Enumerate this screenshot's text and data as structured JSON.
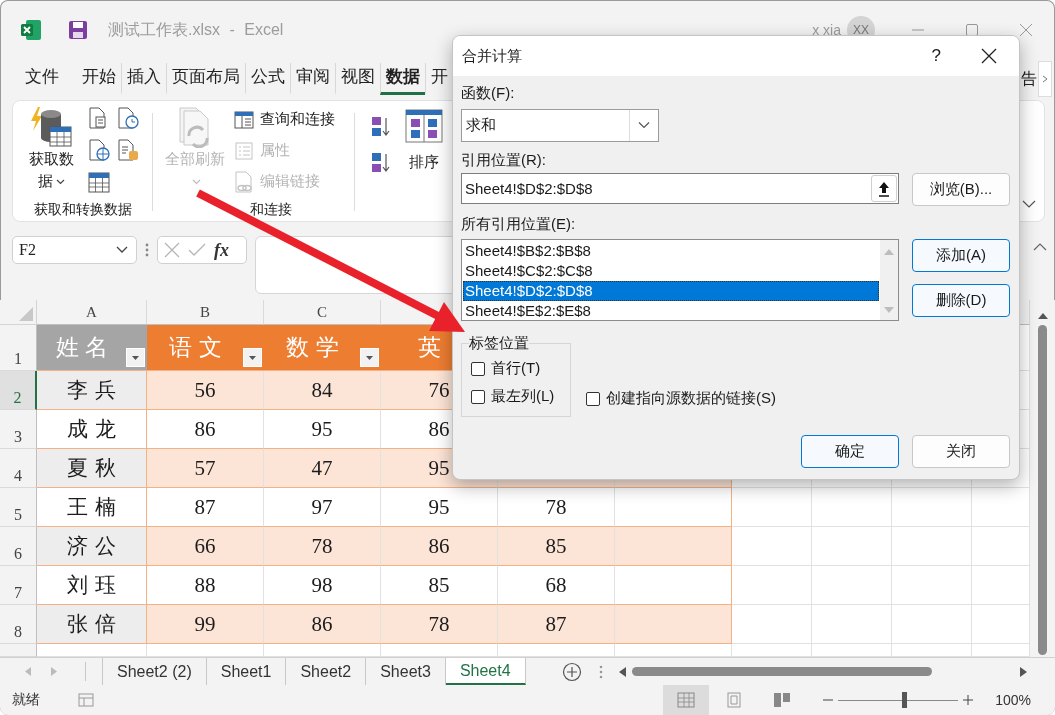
{
  "window": {
    "title": "测试工作表.xlsx - Excel",
    "user": "x xia",
    "avatar": "XX"
  },
  "ribbon_tabs": [
    {
      "label": "文件",
      "selected": false
    },
    {
      "label": "开始",
      "selected": false
    },
    {
      "label": "插入",
      "selected": false
    },
    {
      "label": "页面布局",
      "selected": false
    },
    {
      "label": "公式",
      "selected": false
    },
    {
      "label": "审阅",
      "selected": false
    },
    {
      "label": "视图",
      "selected": false
    },
    {
      "label": "数据",
      "selected": true
    },
    {
      "label": "开",
      "selected": false
    }
  ],
  "ribbon_tab_overflow": "告",
  "ribbon_groups": [
    {
      "label": "获取和转换数据",
      "items": [
        {
          "kind": "large",
          "label": "获取数据",
          "disabled": false,
          "dropdown": true
        },
        {
          "kind": "icons"
        }
      ]
    },
    {
      "label": "和连接",
      "items": [
        {
          "kind": "large",
          "label": "全部刷新",
          "disabled": true,
          "dropdown": true
        },
        {
          "kind": "small",
          "label": "查询和连接",
          "disabled": false
        },
        {
          "kind": "small",
          "label": "属性",
          "disabled": true
        },
        {
          "kind": "small",
          "label": "编辑链接",
          "disabled": true
        }
      ]
    },
    {
      "items": [
        {
          "kind": "sort-icons"
        },
        {
          "kind": "large",
          "label": "排序",
          "disabled": false,
          "dropdown": false
        }
      ]
    }
  ],
  "formula_bar": {
    "name_box": "F2",
    "function_button": "fx"
  },
  "sheet": {
    "columns": [
      "A",
      "B",
      "C"
    ],
    "rows": [
      {
        "number": "1",
        "kind": "header",
        "selected": false,
        "cells": [
          {
            "text": "姓名",
            "filter": true
          },
          {
            "text": "语文",
            "filter": true
          },
          {
            "text": "数学",
            "filter": true
          },
          {
            "text": "英",
            "filter": false
          }
        ]
      },
      {
        "number": "2",
        "kind": "data",
        "selected": true,
        "banded": true,
        "cells": [
          "李兵",
          "56",
          "84",
          "76"
        ]
      },
      {
        "number": "3",
        "kind": "data",
        "selected": false,
        "banded": false,
        "cells": [
          "成龙",
          "86",
          "95",
          "86"
        ]
      },
      {
        "number": "4",
        "kind": "data",
        "selected": false,
        "banded": true,
        "cells": [
          "夏秋",
          "57",
          "47",
          "95"
        ]
      },
      {
        "number": "5",
        "kind": "data",
        "selected": false,
        "banded": false,
        "cells": [
          "王楠",
          "87",
          "97",
          "95",
          "78"
        ]
      },
      {
        "number": "6",
        "kind": "data",
        "selected": false,
        "banded": true,
        "cells": [
          "济公",
          "66",
          "78",
          "86",
          "85"
        ]
      },
      {
        "number": "7",
        "kind": "data",
        "selected": false,
        "banded": false,
        "cells": [
          "刘珏",
          "88",
          "98",
          "85",
          "68"
        ]
      },
      {
        "number": "8",
        "kind": "data",
        "selected": false,
        "banded": true,
        "cells": [
          "张倍",
          "99",
          "86",
          "78",
          "87"
        ]
      }
    ]
  },
  "sheet_tabs": [
    {
      "label": "Sheet2 (2)",
      "selected": false
    },
    {
      "label": "Sheet1",
      "selected": false
    },
    {
      "label": "Sheet2",
      "selected": false
    },
    {
      "label": "Sheet3",
      "selected": false
    },
    {
      "label": "Sheet4",
      "selected": true
    }
  ],
  "status_bar": {
    "text": "就绪",
    "views": [
      {
        "selected": true
      },
      {
        "selected": false
      },
      {
        "selected": false
      }
    ],
    "zoom": {
      "level": 0.55,
      "reading": "100%"
    }
  },
  "dialog": {
    "title": "合并计算",
    "help": "?",
    "function": {
      "label": "函数(F):",
      "value": "求和"
    },
    "reference": {
      "label": "引用位置(R):",
      "value": "Sheet4!$D$2:$D$8",
      "browse": {
        "label": "浏览(B)...",
        "default": false
      }
    },
    "all_references": {
      "label": "所有引用位置(E):",
      "items": [
        {
          "text": "Sheet4!$B$2:$B$8",
          "selected": false
        },
        {
          "text": "Sheet4!$C$2:$C$8",
          "selected": false
        },
        {
          "text": "Sheet4!$D$2:$D$8",
          "selected": true
        },
        {
          "text": "Sheet4!$E$2:$E$8",
          "selected": false
        }
      ],
      "buttons": [
        {
          "label": "添加(A)",
          "default": true
        },
        {
          "label": "删除(D)",
          "default": true
        }
      ]
    },
    "label_position": {
      "title": "标签位置",
      "options": [
        {
          "label": "首行(T)",
          "checked": false
        },
        {
          "label": "最左列(L)",
          "checked": false
        }
      ]
    },
    "link_option": {
      "label": "创建指向源数据的链接(S)",
      "checked": false
    },
    "buttons": [
      {
        "label": "确定",
        "default": true
      },
      {
        "label": "关闭",
        "default": false
      }
    ]
  }
}
